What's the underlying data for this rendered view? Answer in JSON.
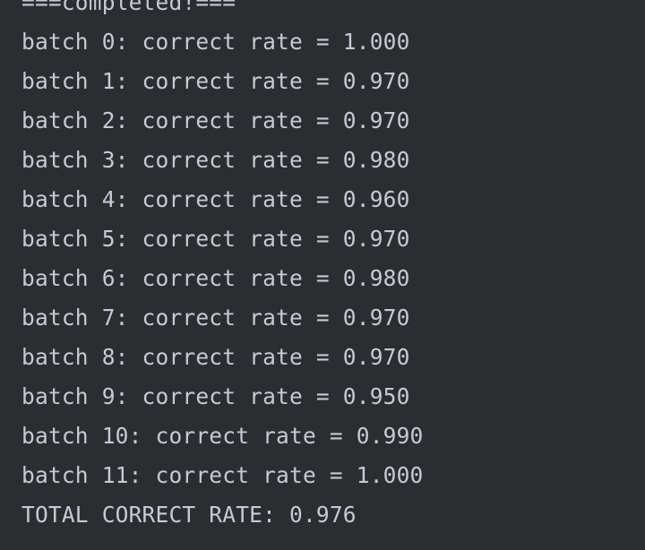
{
  "console": {
    "lines": [
      "===completed!===",
      "batch 0: correct rate = 1.000",
      "batch 1: correct rate = 0.970",
      "batch 2: correct rate = 0.970",
      "batch 3: correct rate = 0.980",
      "batch 4: correct rate = 0.960",
      "batch 5: correct rate = 0.970",
      "batch 6: correct rate = 0.980",
      "batch 7: correct rate = 0.970",
      "batch 8: correct rate = 0.970",
      "batch 9: correct rate = 0.950",
      "batch 10: correct rate = 0.990",
      "batch 11: correct rate = 1.000",
      "TOTAL CORRECT RATE: 0.976"
    ]
  },
  "colors": {
    "background": "#2b2d30",
    "text": "#c7cad1"
  }
}
